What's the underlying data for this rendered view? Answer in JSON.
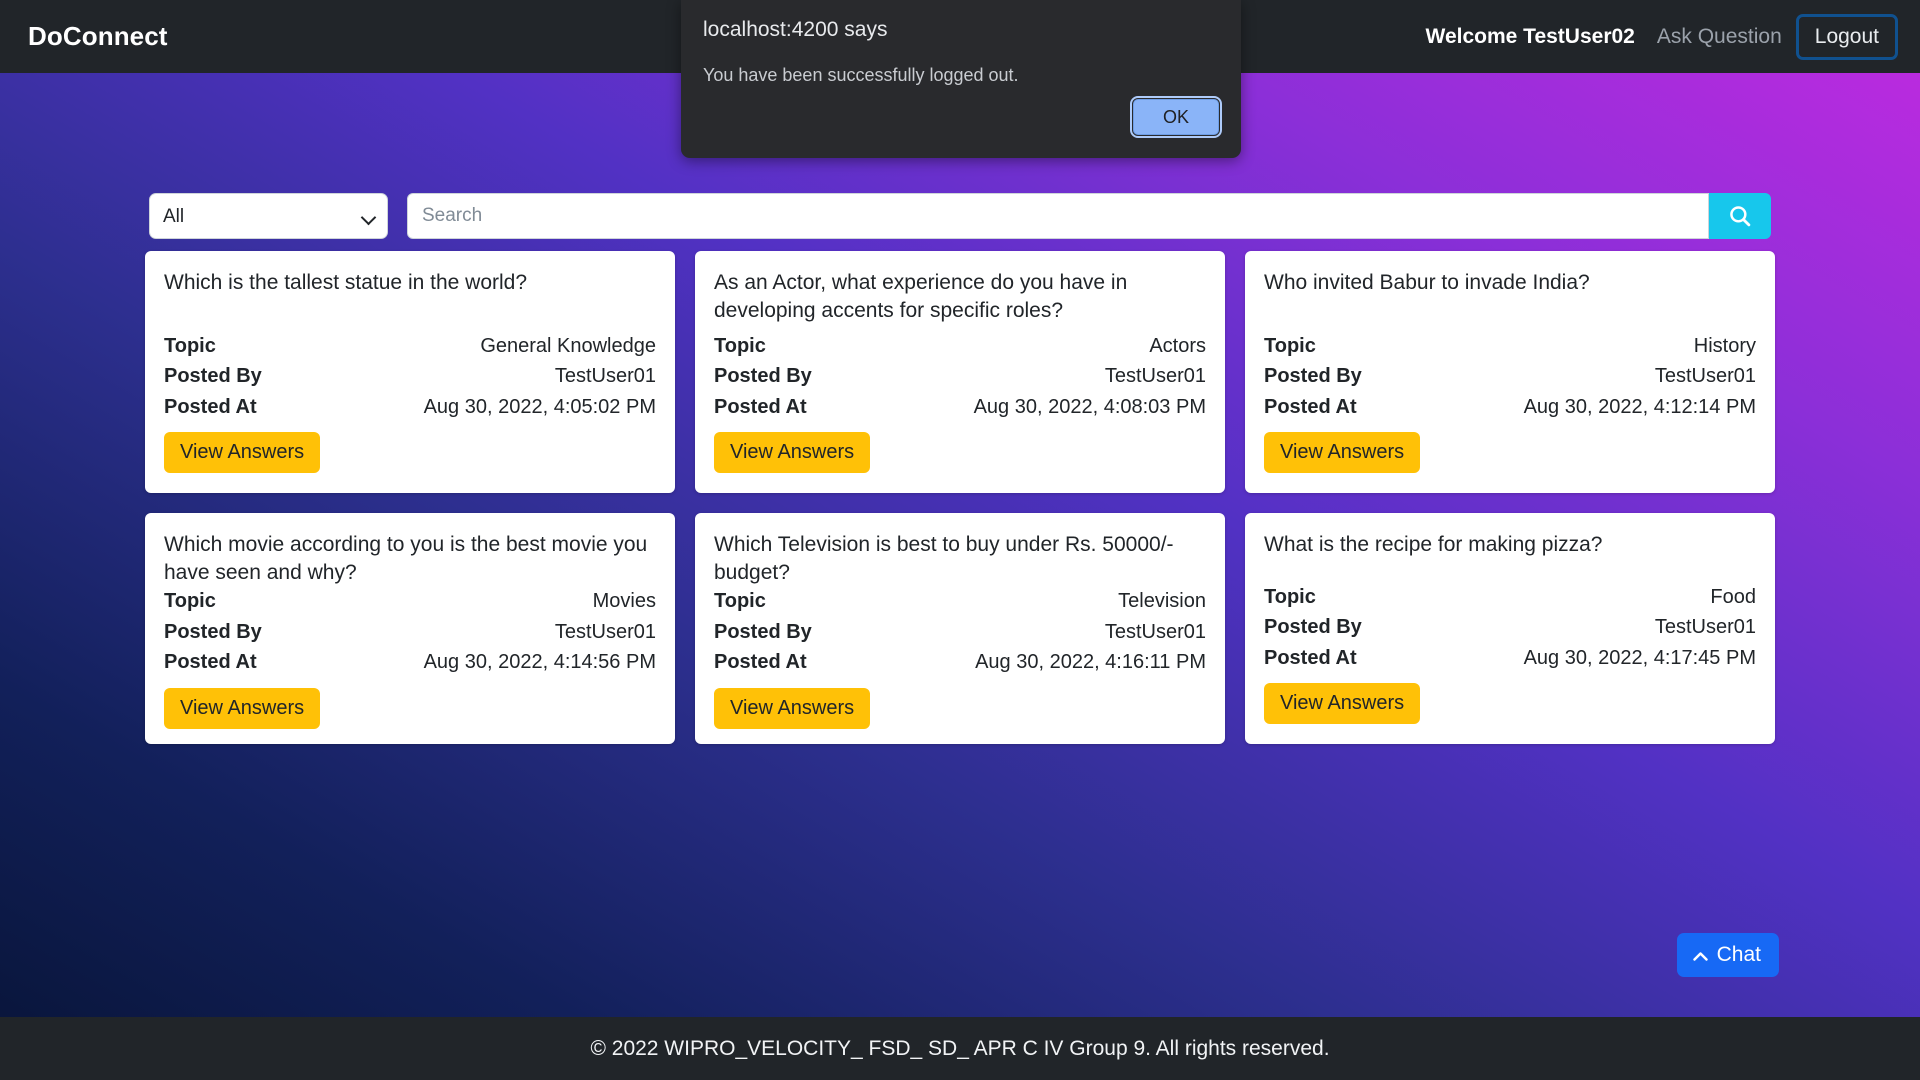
{
  "header": {
    "brand": "DoConnect",
    "welcome": "Welcome TestUser02",
    "ask_question": "Ask Question",
    "logout": "Logout"
  },
  "search": {
    "selected_topic": "All",
    "topic_options": [
      "All"
    ],
    "placeholder": "Search",
    "value": "",
    "search_icon": "search-icon",
    "button_color": "#17c7ec"
  },
  "dialog": {
    "origin": "localhost:4200 says",
    "message": "You have been successfully logged out.",
    "ok_label": "OK"
  },
  "card_labels": {
    "topic": "Topic",
    "posted_by": "Posted By",
    "posted_at": "Posted At",
    "view_answers": "View Answers"
  },
  "questions": [
    {
      "title": "Which is the tallest statue in the world?",
      "topic": "General Knowledge",
      "posted_by": "TestUser01",
      "posted_at": "Aug 30, 2022, 4:05:02 PM"
    },
    {
      "title": "As an Actor, what experience do you have in developing accents for specific roles?",
      "topic": "Actors",
      "posted_by": "TestUser01",
      "posted_at": "Aug 30, 2022, 4:08:03 PM"
    },
    {
      "title": "Who invited Babur to invade India?",
      "topic": "History",
      "posted_by": "TestUser01",
      "posted_at": "Aug 30, 2022, 4:12:14 PM"
    },
    {
      "title": "Which movie according to you is the best movie you have seen and why?",
      "topic": "Movies",
      "posted_by": "TestUser01",
      "posted_at": "Aug 30, 2022, 4:14:56 PM"
    },
    {
      "title": "Which Television is best to buy under Rs. 50000/- budget?",
      "topic": "Television",
      "posted_by": "TestUser01",
      "posted_at": "Aug 30, 2022, 4:16:11 PM"
    },
    {
      "title": "What is the recipe for making pizza?",
      "topic": "Food",
      "posted_by": "TestUser01",
      "posted_at": "Aug 30, 2022, 4:17:45 PM"
    }
  ],
  "chat": {
    "label": "Chat",
    "icon": "chevron-up-icon",
    "color": "#1769f5"
  },
  "footer": {
    "text": "© 2022 WIPRO_VELOCITY_ FSD_ SD_ APR C IV Group 9. All rights reserved."
  },
  "theme": {
    "navbar_bg": "#212529",
    "accent_yellow": "#ffc107",
    "accent_cyan": "#17c7ec",
    "gradient_from": "#081437",
    "gradient_to": "#c22ae0"
  }
}
